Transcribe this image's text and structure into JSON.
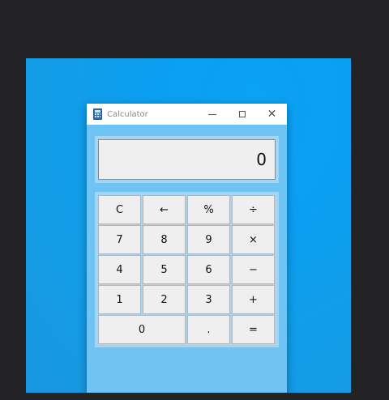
{
  "window": {
    "title": "Calculator",
    "icon": "calculator-icon"
  },
  "controls": {
    "minimize": "—",
    "maximize": "□",
    "close": "✕"
  },
  "display": {
    "value": "0"
  },
  "keys": [
    {
      "label": "C",
      "name": "clear-button"
    },
    {
      "label": "←",
      "name": "backspace-button"
    },
    {
      "label": "%",
      "name": "percent-button"
    },
    {
      "label": "÷",
      "name": "divide-button"
    },
    {
      "label": "7",
      "name": "digit-7-button"
    },
    {
      "label": "8",
      "name": "digit-8-button"
    },
    {
      "label": "9",
      "name": "digit-9-button"
    },
    {
      "label": "×",
      "name": "multiply-button"
    },
    {
      "label": "4",
      "name": "digit-4-button"
    },
    {
      "label": "5",
      "name": "digit-5-button"
    },
    {
      "label": "6",
      "name": "digit-6-button"
    },
    {
      "label": "−",
      "name": "subtract-button"
    },
    {
      "label": "1",
      "name": "digit-1-button"
    },
    {
      "label": "2",
      "name": "digit-2-button"
    },
    {
      "label": "3",
      "name": "digit-3-button"
    },
    {
      "label": "+",
      "name": "add-button"
    },
    {
      "label": "0",
      "name": "digit-0-button"
    },
    {
      "label": ".",
      "name": "decimal-button"
    },
    {
      "label": "=",
      "name": "equals-button"
    }
  ]
}
